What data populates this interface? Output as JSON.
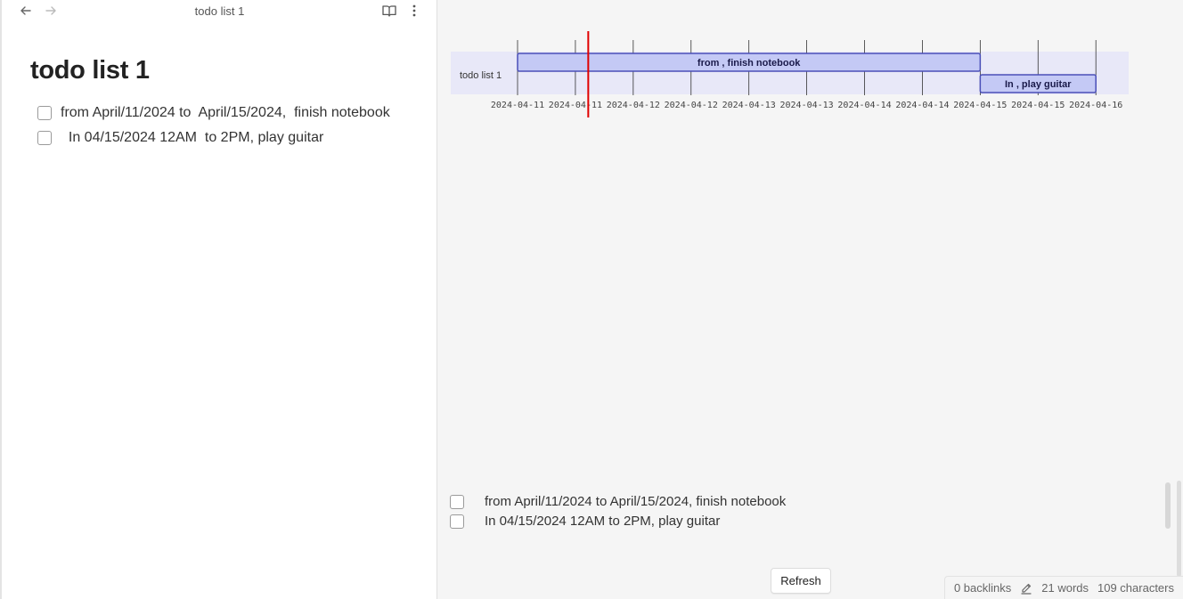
{
  "nav": {
    "title": "todo list 1",
    "back_icon": "arrow-left-icon",
    "forward_icon": "arrow-right-icon",
    "reading_view_icon": "book-open-icon",
    "more_options_icon": "more-vertical-icon"
  },
  "document": {
    "title": "todo list 1",
    "tasks": [
      {
        "text": "from April/11/2024 to  April/15/2024,  finish notebook",
        "checked": false
      },
      {
        "text": "  In 04/15/2024 12AM  to 2PM, play guitar",
        "checked": false
      }
    ]
  },
  "chart_data": {
    "type": "gantt",
    "section": "todo list 1",
    "tasks": [
      {
        "label": "from , finish notebook",
        "start": "2024-04-11T00:00",
        "end": "2024-04-15T00:00",
        "row": 0
      },
      {
        "label": "In , play guitar",
        "start": "2024-04-15T00:00",
        "end": "2024-04-16T00:00",
        "row": 1
      }
    ],
    "axis_start": "2024-04-11T00:00",
    "axis_tick_step_hours": 12,
    "tick_labels": [
      "2024-04-11",
      "2024-04-11",
      "2024-04-12",
      "2024-04-12",
      "2024-04-13",
      "2024-04-13",
      "2024-04-14",
      "2024-04-14",
      "2024-04-15",
      "2024-04-15",
      "2024-04-16"
    ],
    "today_marker": "2024-04-11T14:40",
    "colors": {
      "bar_fill": "#c4c9f5",
      "bar_stroke": "#4a4fb8",
      "section_bg": "#e8e8f8",
      "today_line": "#e00000",
      "grid": "#333333"
    }
  },
  "results": {
    "items": [
      {
        "text": "from April/11/2024 to April/15/2024, finish notebook",
        "checked": false
      },
      {
        "text": "In 04/15/2024 12AM to 2PM, play guitar",
        "checked": false
      }
    ],
    "refresh_label": "Refresh"
  },
  "status": {
    "backlinks": "0 backlinks",
    "edit_icon": "pencil-icon",
    "words": "21 words",
    "characters": "109 characters"
  }
}
